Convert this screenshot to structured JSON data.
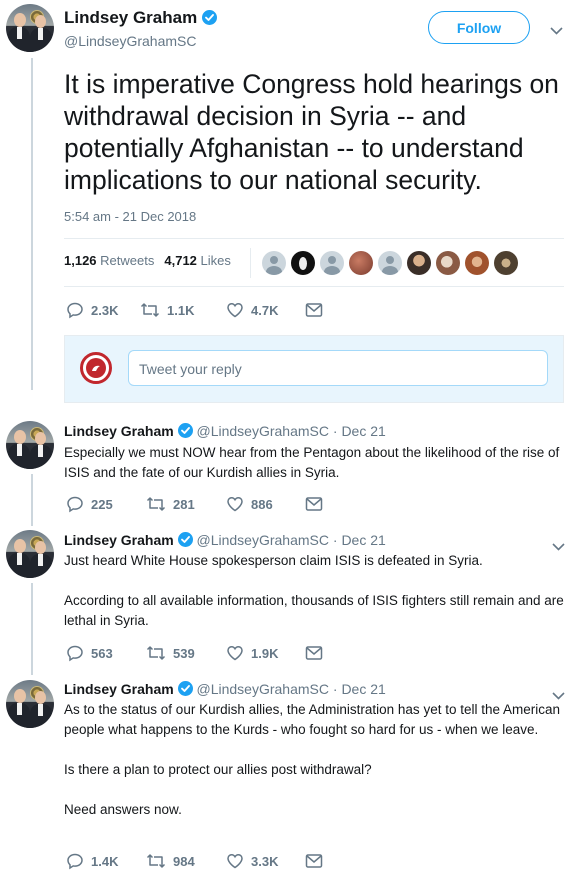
{
  "main_tweet": {
    "author_name": "Lindsey Graham",
    "author_handle": "@LindseyGrahamSC",
    "follow_label": "Follow",
    "text": "It is imperative Congress hold hearings on withdrawal decision in Syria -- and potentially Afghanistan -- to understand implications to our national security.",
    "timestamp": "5:54 am - 21 Dec 2018",
    "retweets_count": "1,126",
    "retweets_label": "Retweets",
    "likes_count": "4,712",
    "likes_label": "Likes",
    "reply_count": "2.3K",
    "retweet_count": "1.1K",
    "like_count": "4.7K"
  },
  "likers": [
    "default-avatar",
    "penguin-avatar",
    "default-avatar",
    "dog-avatar",
    "default-avatar",
    "person-avatar",
    "cat-avatar",
    "woman-avatar",
    "hedgehog-avatar"
  ],
  "reply_box": {
    "placeholder": "Tweet your reply"
  },
  "thread": [
    {
      "author_name": "Lindsey Graham",
      "author_handle": "@LindseyGrahamSC",
      "date": "Dec 21",
      "paragraphs": [
        "Especially we must NOW hear from the Pentagon about the likelihood of the rise of ISIS and the fate of our Kurdish allies in Syria."
      ],
      "replies": "225",
      "retweets": "281",
      "likes": "886"
    },
    {
      "author_name": "Lindsey Graham",
      "author_handle": "@LindseyGrahamSC",
      "date": "Dec 21",
      "paragraphs": [
        "Just heard White House spokesperson claim ISIS is defeated in Syria.",
        "According to all available information, thousands of ISIS fighters still remain and are lethal in Syria."
      ],
      "replies": "563",
      "retweets": "539",
      "likes": "1.9K"
    },
    {
      "author_name": "Lindsey Graham",
      "author_handle": "@LindseyGrahamSC",
      "date": "Dec 21",
      "paragraphs": [
        "As to the status of our Kurdish allies, the Administration has yet to tell the American people what happens to the Kurds - who fought so hard for us - when we leave.",
        "Is there a plan to protect our allies post withdrawal?",
        "Need answers now."
      ],
      "replies": "1.4K",
      "retweets": "984",
      "likes": "3.3K"
    }
  ],
  "colors": {
    "accent": "#1da1f2",
    "muted": "#657786",
    "text": "#14171a",
    "border": "#e6ecf0"
  }
}
